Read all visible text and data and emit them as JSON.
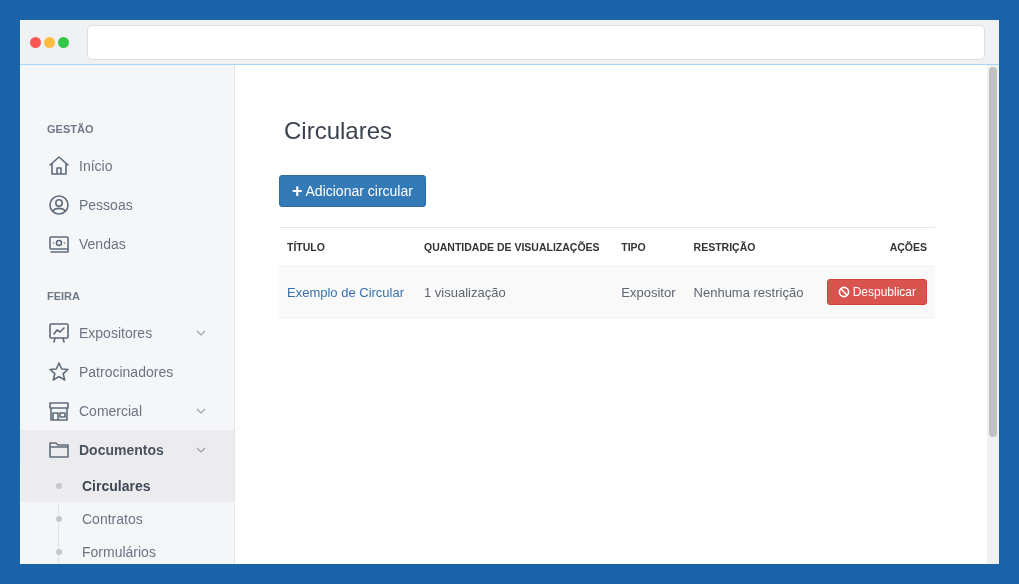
{
  "sidebar": {
    "sections": [
      {
        "title": "GESTÃO",
        "items": [
          {
            "label": "Início",
            "kind": "link",
            "selected": false
          },
          {
            "label": "Pessoas",
            "kind": "link",
            "selected": false
          },
          {
            "label": "Vendas",
            "kind": "link",
            "selected": false
          }
        ]
      },
      {
        "title": "FEIRA",
        "items": [
          {
            "label": "Expositores",
            "kind": "group",
            "selected": false
          },
          {
            "label": "Patrocinadores",
            "kind": "link",
            "selected": false
          },
          {
            "label": "Comercial",
            "kind": "group",
            "selected": false
          },
          {
            "label": "Documentos",
            "kind": "group",
            "selected": true,
            "children": [
              {
                "label": "Circulares",
                "selected": true
              },
              {
                "label": "Contratos",
                "selected": false
              },
              {
                "label": "Formulários",
                "selected": false
              }
            ]
          }
        ]
      }
    ]
  },
  "page": {
    "title": "Circulares",
    "add_button": {
      "icon": "+",
      "label": "Adicionar circular"
    }
  },
  "table": {
    "columns": [
      "TÍTULO",
      "QUANTIDADE DE VISUALIZAÇÕES",
      "TIPO",
      "RESTRIÇÃO",
      "AÇÕES"
    ],
    "rows": [
      {
        "title": "Exemplo de Circular",
        "views": "1 visualização",
        "type": "Expositor",
        "restriction": "Nenhuma restrição",
        "action": "Despublicar"
      }
    ]
  }
}
